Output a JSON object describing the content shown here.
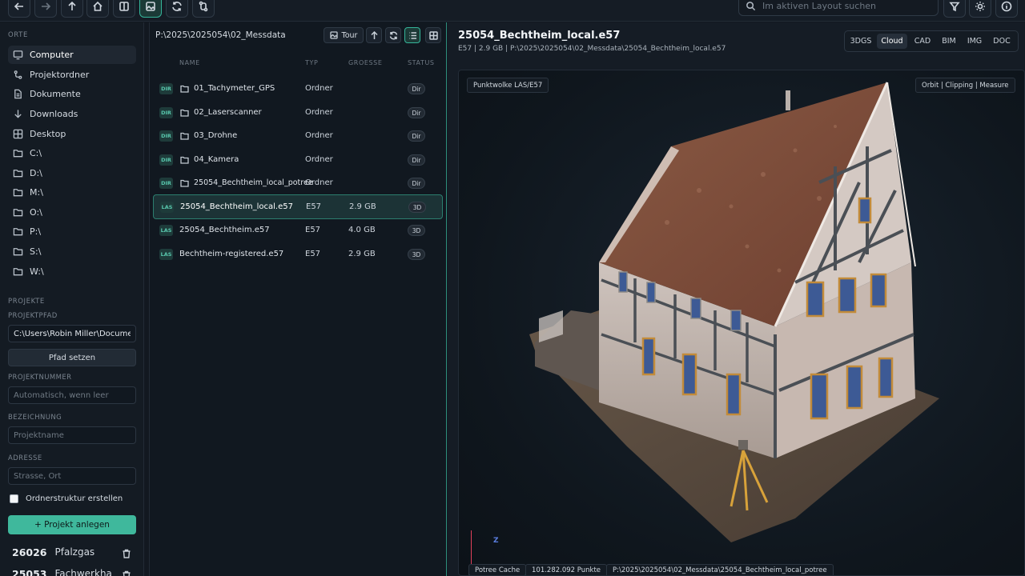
{
  "toolbar": {
    "search_placeholder": "Im aktiven Layout suchen"
  },
  "sidebar": {
    "places_title": "ORTE",
    "places": [
      {
        "label": "Computer",
        "icon": "computer-icon",
        "active": true
      },
      {
        "label": "Projektordner",
        "icon": "project-folder-icon"
      },
      {
        "label": "Dokumente",
        "icon": "document-icon"
      },
      {
        "label": "Downloads",
        "icon": "download-icon"
      },
      {
        "label": "Desktop",
        "icon": "desktop-icon"
      },
      {
        "label": "C:\\",
        "icon": "folder-icon"
      },
      {
        "label": "D:\\",
        "icon": "folder-icon"
      },
      {
        "label": "M:\\",
        "icon": "folder-icon"
      },
      {
        "label": "O:\\",
        "icon": "folder-icon"
      },
      {
        "label": "P:\\",
        "icon": "folder-icon"
      },
      {
        "label": "S:\\",
        "icon": "folder-icon"
      },
      {
        "label": "W:\\",
        "icon": "folder-icon"
      }
    ],
    "projects_title": "PROJEKTE",
    "project_path_label": "PROJEKTPFAD",
    "project_path_value": "C:\\Users\\Robin Miller\\Documents\\",
    "set_path_label": "Pfad setzen",
    "project_number_label": "PROJEKTNUMMER",
    "project_number_placeholder": "Automatisch, wenn leer",
    "name_label": "BEZEICHNUNG",
    "name_placeholder": "Projektname",
    "address_label": "ADRESSE",
    "address_placeholder": "Strasse, Ort",
    "create_structure_label": "Ordnerstruktur erstellen",
    "create_project_label": "+  Projekt anlegen",
    "projects": [
      {
        "number": "26026",
        "name": "Pfalzgas"
      },
      {
        "number": "25053",
        "name": "Fachwerkha"
      }
    ]
  },
  "files": {
    "path": "P:\\2025\\2025054\\02_Messdata",
    "tour_label": "Tour",
    "columns": {
      "name": "NAME",
      "type": "TYP",
      "size": "GROESSE",
      "status": "STATUS"
    },
    "rows": [
      {
        "tag": "DIR",
        "name": "01_Tachymeter_GPS",
        "type": "Ordner",
        "size": "",
        "status": "Dir",
        "folder": true
      },
      {
        "tag": "DIR",
        "name": "02_Laserscanner",
        "type": "Ordner",
        "size": "",
        "status": "Dir",
        "folder": true
      },
      {
        "tag": "DIR",
        "name": "03_Drohne",
        "type": "Ordner",
        "size": "",
        "status": "Dir",
        "folder": true
      },
      {
        "tag": "DIR",
        "name": "04_Kamera",
        "type": "Ordner",
        "size": "",
        "status": "Dir",
        "folder": true
      },
      {
        "tag": "DIR",
        "name": "25054_Bechtheim_local_potree",
        "type": "Ordner",
        "size": "",
        "status": "Dir",
        "folder": true
      },
      {
        "tag": "LAS",
        "name": "25054_Bechtheim_local.e57",
        "type": "E57",
        "size": "2.9 GB",
        "status": "3D",
        "selected": true
      },
      {
        "tag": "LAS",
        "name": "25054_Bechtheim.e57",
        "type": "E57",
        "size": "4.0 GB",
        "status": "3D"
      },
      {
        "tag": "LAS",
        "name": "Bechtheim-registered.e57",
        "type": "E57",
        "size": "2.9 GB",
        "status": "3D"
      }
    ]
  },
  "viewer": {
    "title": "25054_Bechtheim_local.e57",
    "subtitle": "E57 | 2.9 GB | P:\\2025\\2025054\\02_Messdata\\25054_Bechtheim_local.e57",
    "tabs": [
      "3DGS",
      "Cloud",
      "CAD",
      "BIM",
      "IMG",
      "DOC"
    ],
    "active_tab": "Cloud",
    "badge_left": "Punktwolke LAS/E57",
    "badge_right": "Orbit | Clipping | Measure",
    "axis_label": "Z",
    "status": {
      "cache": "Potree Cache",
      "points": "101.282.092 Punkte",
      "path": "P:\\2025\\2025054\\02_Messdata\\25054_Bechtheim_local_potree"
    }
  }
}
